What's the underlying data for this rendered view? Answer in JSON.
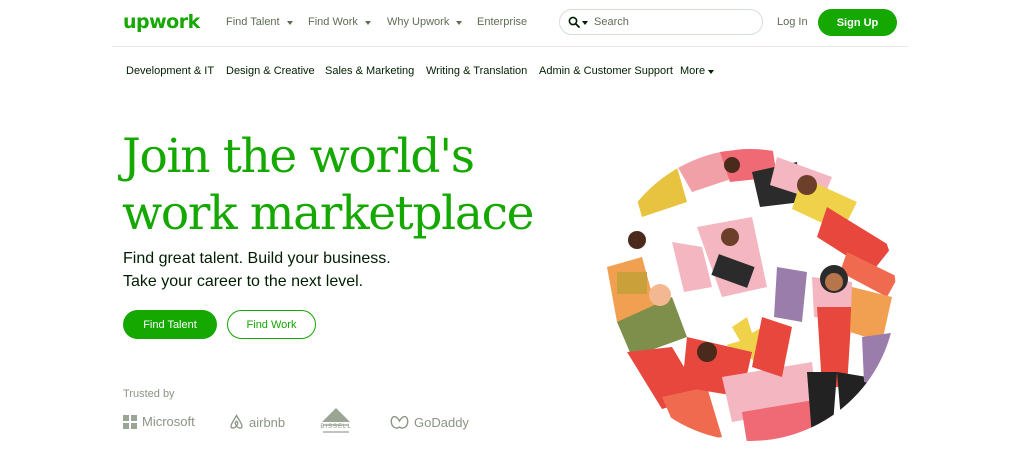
{
  "header": {
    "logo": "upwork",
    "nav": [
      {
        "label": "Find Talent",
        "dropdown": true
      },
      {
        "label": "Find Work",
        "dropdown": true
      },
      {
        "label": "Why Upwork",
        "dropdown": true
      },
      {
        "label": "Enterprise",
        "dropdown": false
      }
    ],
    "search_placeholder": "Search",
    "login": "Log In",
    "signup": "Sign Up"
  },
  "categories": [
    "Development & IT",
    "Design & Creative",
    "Sales & Marketing",
    "Writing & Translation",
    "Admin & Customer Support",
    "More"
  ],
  "hero": {
    "title_line1": "Join the world's",
    "title_line2": "work marketplace",
    "subtitle_line1": "Find great talent. Build your business.",
    "subtitle_line2": "Take your career to the next level.",
    "primary_cta": "Find Talent",
    "secondary_cta": "Find Work"
  },
  "trusted": {
    "label": "Trusted by",
    "brands": [
      "Microsoft",
      "airbnb",
      "BISSELL",
      "GoDaddy"
    ]
  },
  "colors": {
    "brand_green": "#14a800",
    "text_dark": "#001e00",
    "text_muted": "#5e6d55"
  },
  "icons": {
    "search": "search-icon",
    "dropdown": "chevron-down-icon"
  }
}
